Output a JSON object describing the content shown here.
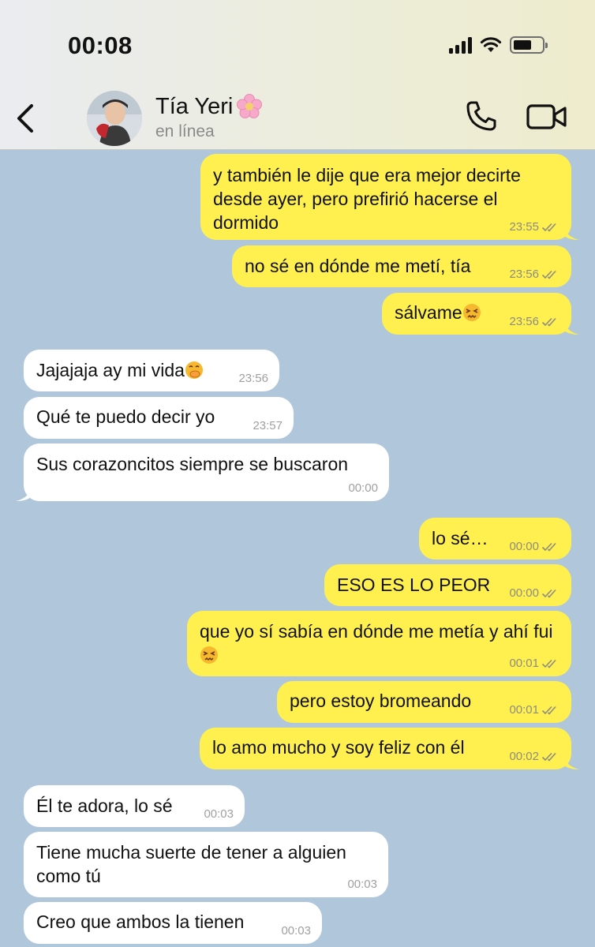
{
  "status_bar": {
    "time": "00:08"
  },
  "header": {
    "contact_name": "Tía Yeri",
    "contact_status": "en línea"
  },
  "messages": [
    {
      "dir": "out",
      "text": "y también le dije que era mejor decirte desde ayer, pero prefirió hacerse el dormido",
      "time": "23:55"
    },
    {
      "dir": "out",
      "text": "no sé en dónde me metí, tía",
      "time": "23:56"
    },
    {
      "dir": "out",
      "text": "sálvame",
      "time": "23:56",
      "emoji": "confounded-face"
    },
    {
      "dir": "in",
      "text": "Jajajaja ay mi vida",
      "time": "23:56",
      "emoji": "hand-over-mouth-face"
    },
    {
      "dir": "in",
      "text": "Qué te puedo decir yo",
      "time": "23:57"
    },
    {
      "dir": "in",
      "text": "Sus corazoncitos siempre se buscaron",
      "time": "00:00"
    },
    {
      "dir": "out",
      "text": "lo sé…",
      "time": "00:00"
    },
    {
      "dir": "out",
      "text": "ESO ES LO PEOR",
      "time": "00:00"
    },
    {
      "dir": "out",
      "text": "que yo sí sabía en dónde me metía y ahí fui",
      "time": "00:01",
      "emoji": "confounded-face"
    },
    {
      "dir": "out",
      "text": "pero estoy bromeando",
      "time": "00:01"
    },
    {
      "dir": "out",
      "text": "lo amo mucho y soy feliz con él",
      "time": "00:02"
    },
    {
      "dir": "in",
      "text": "Él te adora, lo sé",
      "time": "00:03"
    },
    {
      "dir": "in",
      "text": "Tiene mucha suerte de tener a alguien como tú",
      "time": "00:03"
    },
    {
      "dir": "in",
      "text": "Creo que ambos la tienen",
      "time": "00:03"
    }
  ],
  "colors": {
    "outgoing_bubble": "#fff04f",
    "incoming_bubble": "#ffffff",
    "chat_background": "#afc6db"
  }
}
